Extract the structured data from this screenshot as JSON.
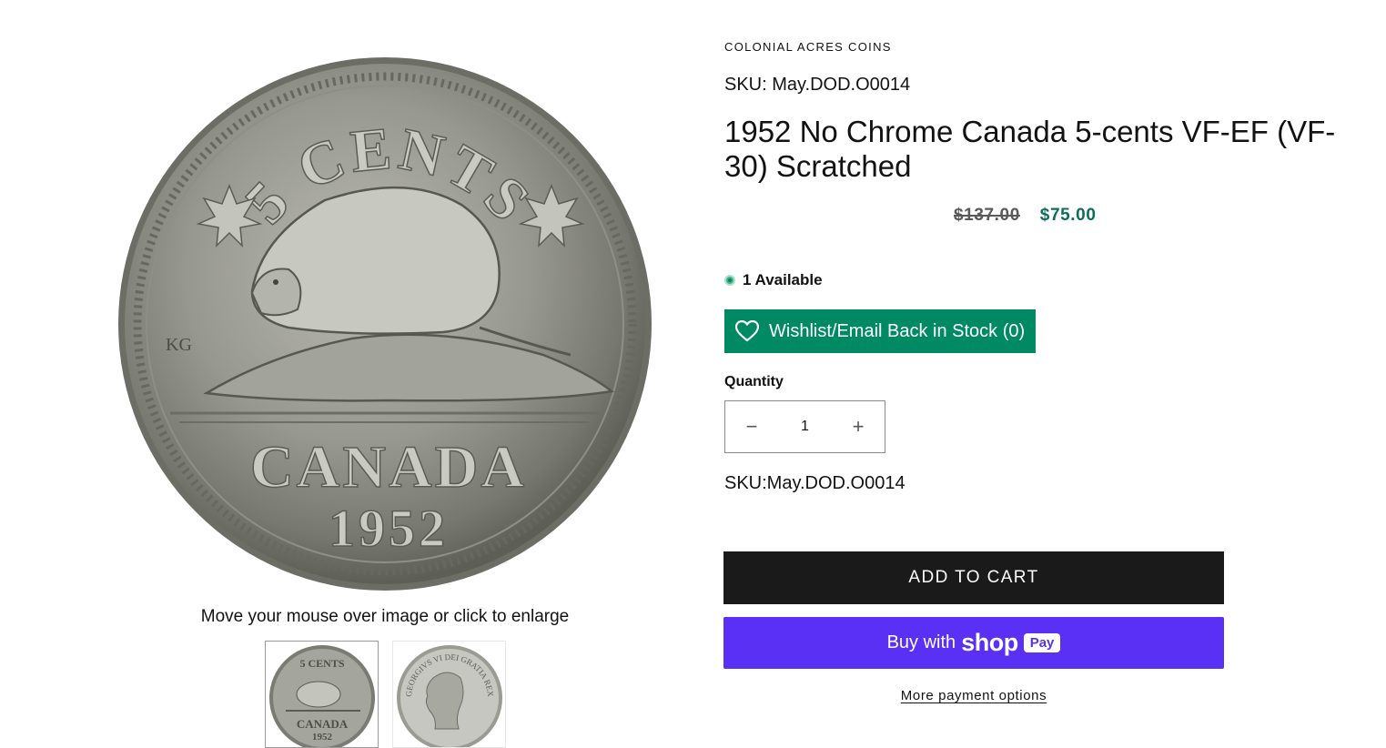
{
  "gallery": {
    "main_image": {
      "top_text": "5 CENTS",
      "country": "CANADA",
      "year": "1952",
      "initials": "KG"
    },
    "hint": "Move your mouse over image or click to enlarge",
    "thumbnails": [
      {
        "top_text": "5 CENTS",
        "country": "CANADA",
        "year": "1952"
      },
      {
        "legend": "GEORGIVS VI DEI GRATIA REX"
      }
    ]
  },
  "product": {
    "vendor": "COLONIAL ACRES COINS",
    "sku_top": "SKU: May.DOD.O0014",
    "title": "1952 No Chrome Canada 5-cents VF-EF (VF-30) Scratched",
    "price_compare": "$137.00",
    "price_sale": "$75.00",
    "availability": "1 Available",
    "wishlist_label": "Wishlist/Email Back in Stock (0)",
    "quantity_label": "Quantity",
    "quantity_value": "1",
    "qty_minus": "−",
    "qty_plus": "+",
    "sku_bottom": "SKU:May.DOD.O0014",
    "add_to_cart": "ADD TO CART",
    "buy_with": "Buy with",
    "shop_word": "shop",
    "pay_word": "Pay",
    "more_payment": "More payment options"
  },
  "colors": {
    "sale_price": "#0e6e5c",
    "wishlist_bg": "#008a64",
    "add_to_cart_bg": "#1a1a1a",
    "shop_pay_bg": "#5a31f4",
    "available_dot": "#3fb58a"
  },
  "icons": {
    "wishlist": "heart-outline-icon",
    "availability": "status-dot-icon"
  }
}
